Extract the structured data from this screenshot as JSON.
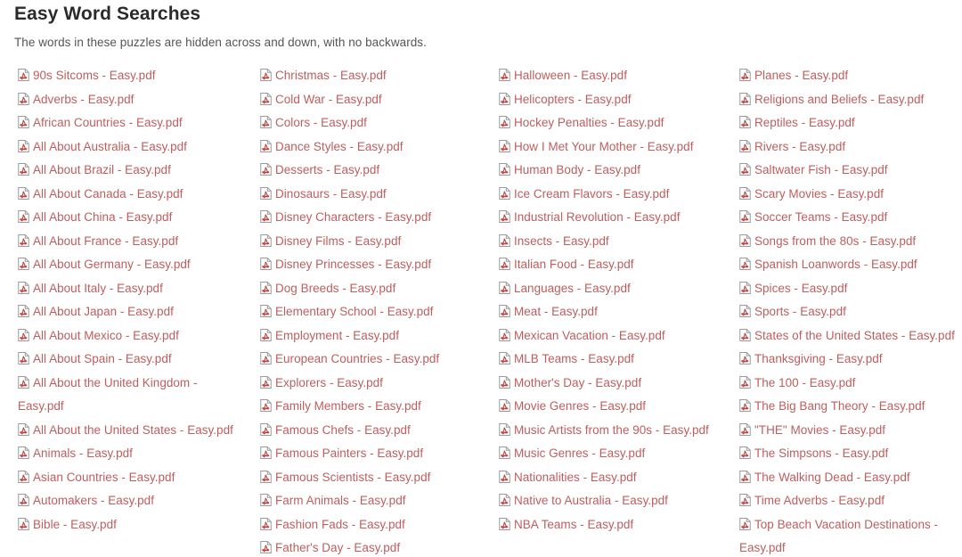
{
  "header": {
    "title": "Easy Word Searches",
    "subtitle": "The words in these puzzles are hidden across and down, with no backwards."
  },
  "icons": {
    "file_icon_name": "pdf-file-icon",
    "icon_page_color": "#9a9a9a",
    "icon_mark_color": "#c23b3b"
  },
  "colors": {
    "background": "#ffffff",
    "title_text": "#2b2b2b",
    "subtitle_text": "#555555",
    "link_text": "#bf5d5d"
  },
  "columns": [
    {
      "name": "column-1",
      "items": [
        "90s Sitcoms - Easy.pdf",
        "Adverbs - Easy.pdf",
        "African Countries - Easy.pdf",
        "All About Australia - Easy.pdf",
        "All About Brazil - Easy.pdf",
        "All About Canada - Easy.pdf",
        "All About China - Easy.pdf",
        "All About France - Easy.pdf",
        "All About Germany - Easy.pdf",
        "All About Italy - Easy.pdf",
        "All About Japan - Easy.pdf",
        "All About Mexico - Easy.pdf",
        "All About Spain - Easy.pdf",
        "All About the United Kingdom - Easy.pdf",
        "All About the United States - Easy.pdf",
        "Animals - Easy.pdf",
        "Asian Countries - Easy.pdf",
        "Automakers - Easy.pdf",
        "Bible - Easy.pdf"
      ]
    },
    {
      "name": "column-2",
      "items": [
        "Christmas - Easy.pdf",
        "Cold War - Easy.pdf",
        "Colors - Easy.pdf",
        "Dance Styles - Easy.pdf",
        "Desserts - Easy.pdf",
        "Dinosaurs - Easy.pdf",
        "Disney Characters - Easy.pdf",
        "Disney Films - Easy.pdf",
        "Disney Princesses - Easy.pdf",
        "Dog Breeds - Easy.pdf",
        "Elementary School - Easy.pdf",
        "Employment - Easy.pdf",
        "European Countries - Easy.pdf",
        "Explorers - Easy.pdf",
        "Family Members - Easy.pdf",
        "Famous Chefs - Easy.pdf",
        "Famous Painters - Easy.pdf",
        "Famous Scientists - Easy.pdf",
        "Farm Animals - Easy.pdf",
        "Fashion Fads - Easy.pdf",
        "Father's Day - Easy.pdf"
      ]
    },
    {
      "name": "column-3",
      "items": [
        "Halloween - Easy.pdf",
        "Helicopters - Easy.pdf",
        "Hockey Penalties - Easy.pdf",
        "How I Met Your Mother - Easy.pdf",
        "Human Body - Easy.pdf",
        "Ice Cream Flavors - Easy.pdf",
        "Industrial Revolution - Easy.pdf",
        "Insects - Easy.pdf",
        "Italian Food - Easy.pdf",
        "Languages - Easy.pdf",
        "Meat - Easy.pdf",
        "Mexican Vacation - Easy.pdf",
        "MLB Teams - Easy.pdf",
        "Mother's Day - Easy.pdf",
        "Movie Genres - Easy.pdf",
        "Music Artists from the 90s - Easy.pdf",
        "Music Genres - Easy.pdf",
        "Nationalities - Easy.pdf",
        "Native to Australia - Easy.pdf",
        "NBA Teams - Easy.pdf"
      ]
    },
    {
      "name": "column-4",
      "items": [
        "Planes - Easy.pdf",
        "Religions and Beliefs - Easy.pdf",
        "Reptiles - Easy.pdf",
        "Rivers - Easy.pdf",
        "Saltwater Fish - Easy.pdf",
        "Scary Movies - Easy.pdf",
        "Soccer Teams - Easy.pdf",
        "Songs from the 80s - Easy.pdf",
        "Spanish Loanwords - Easy.pdf",
        "Spices - Easy.pdf",
        "Sports - Easy.pdf",
        "States of the United States - Easy.pdf",
        "Thanksgiving - Easy.pdf",
        "The 100 - Easy.pdf",
        "The Big Bang Theory - Easy.pdf",
        "\"THE\" Movies - Easy.pdf",
        "The Simpsons - Easy.pdf",
        "The Walking Dead - Easy.pdf",
        "Time Adverbs - Easy.pdf",
        "Top Beach Vacation Destinations - Easy.pdf"
      ]
    }
  ]
}
